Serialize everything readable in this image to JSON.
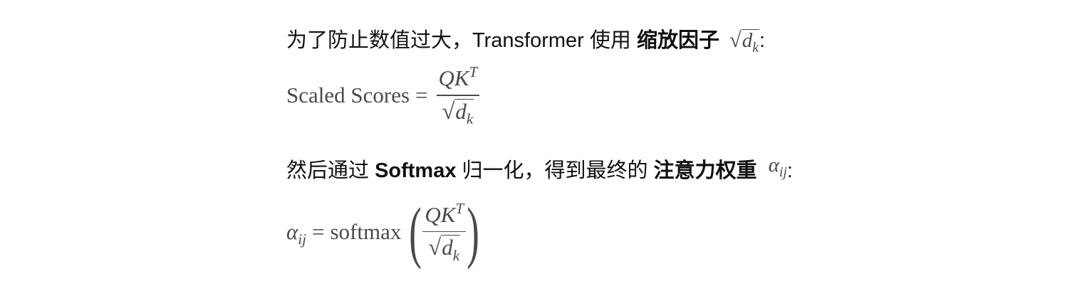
{
  "para1": {
    "prefix": "为了防止数值过大，Transformer 使用 ",
    "bold": "缩放因子",
    "suffix": ":"
  },
  "eq1": {
    "lhs": "Scaled Scores",
    "equals": "=",
    "num_base": "QK",
    "num_sup": "T",
    "den_base": "d",
    "den_sub": "k"
  },
  "para2": {
    "prefix": "然后通过 ",
    "bold1": "Softmax",
    "middle": " 归一化，得到最终的 ",
    "bold2": "注意力权重",
    "suffix": ":"
  },
  "eq2": {
    "lhs_base": "α",
    "lhs_sub": "ij",
    "equals": "=",
    "func": "softmax",
    "num_base": "QK",
    "num_sup": "T",
    "den_base": "d",
    "den_sub": "k"
  },
  "symbols": {
    "sqrt_var": "d",
    "sqrt_sub": "k",
    "alpha": "α",
    "alpha_sub": "ij"
  }
}
